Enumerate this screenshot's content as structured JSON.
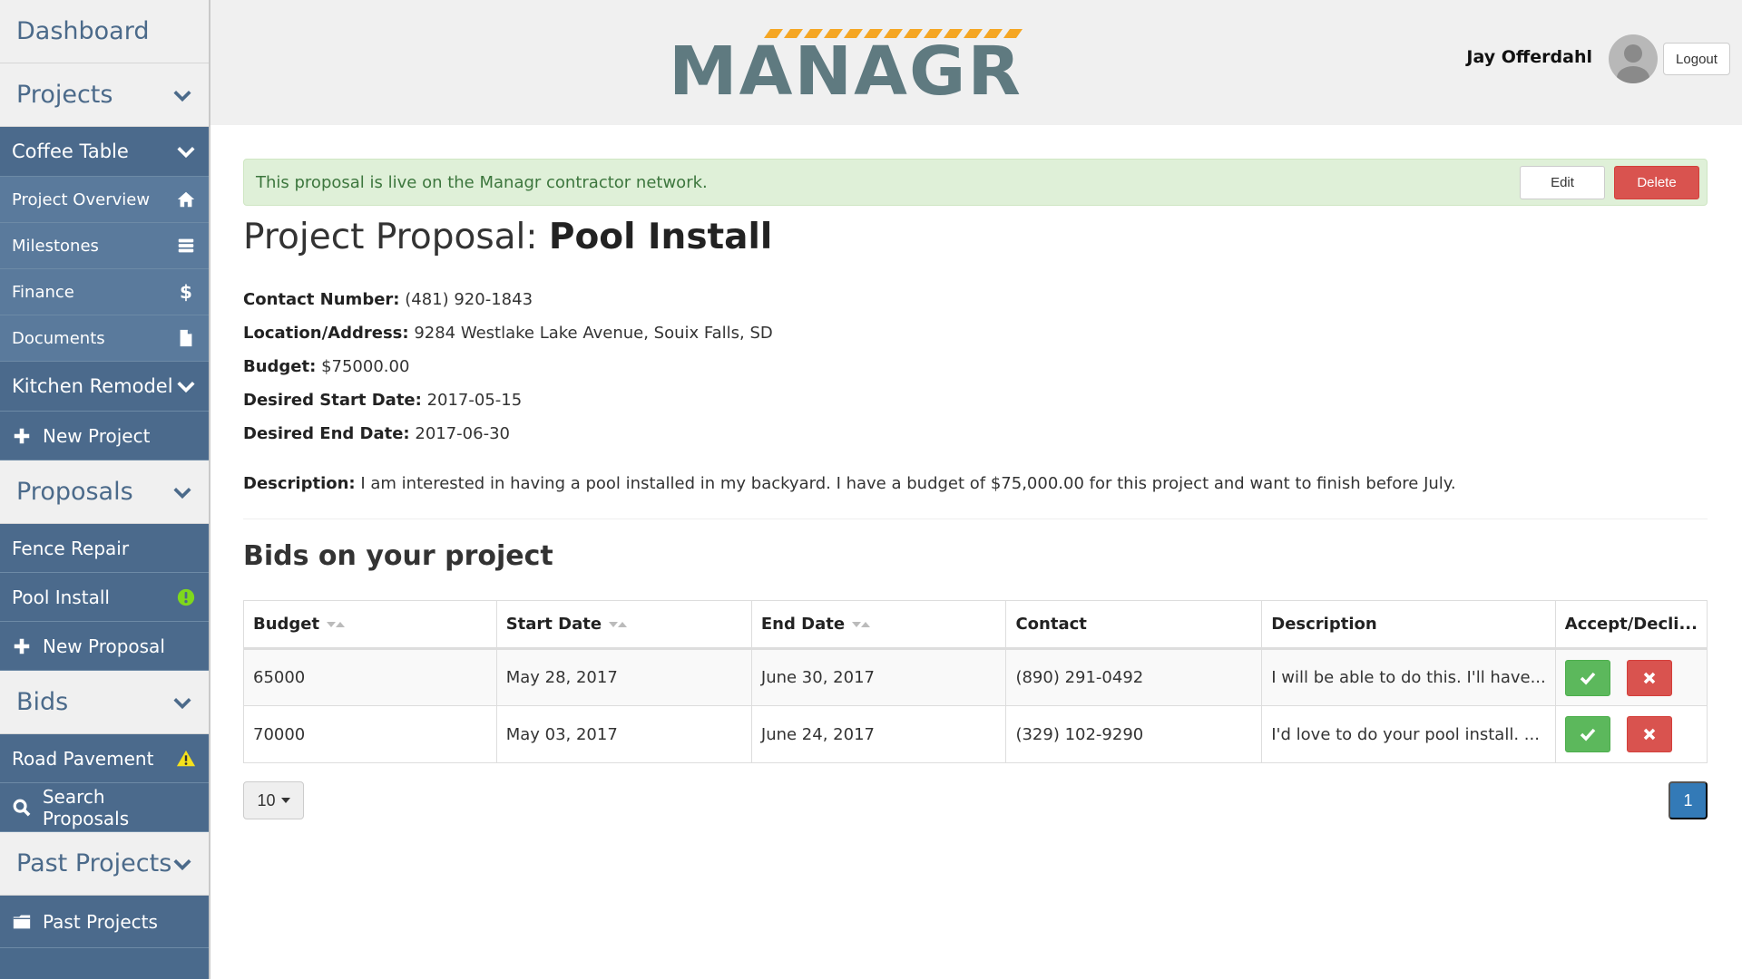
{
  "sidebar": {
    "dashboard": "Dashboard",
    "projects_header": "Projects",
    "projects": [
      {
        "label": "Coffee Table",
        "sub_items": [
          {
            "label": "Project Overview",
            "icon": "home-icon"
          },
          {
            "label": "Milestones",
            "icon": "list-icon"
          },
          {
            "label": "Finance",
            "icon": "dollar-icon"
          },
          {
            "label": "Documents",
            "icon": "document-icon"
          }
        ]
      },
      {
        "label": "Kitchen Remodel"
      }
    ],
    "new_project": "New Project",
    "proposals_header": "Proposals",
    "proposals": [
      {
        "label": "Fence Repair"
      },
      {
        "label": "Pool Install",
        "badge_icon": "exclamation-circle-icon",
        "badge_color": "#7fd81c"
      }
    ],
    "new_proposal": "New Proposal",
    "bids_header": "Bids",
    "bids": [
      {
        "label": "Road Pavement",
        "badge_icon": "warning-icon",
        "badge_color": "#f5e11b"
      }
    ],
    "search_proposals": "Search Proposals",
    "past_projects_header": "Past Projects",
    "past_projects": "Past Projects"
  },
  "header": {
    "logo_text": "MANAGR",
    "logo_stripe_color": "#f5a623",
    "logo_text_color": "#5f7a80",
    "user_name": "Jay Offerdahl",
    "logout_label": "Logout"
  },
  "alert": {
    "text": "This proposal is live on the Managr contractor network.",
    "edit_label": "Edit",
    "delete_label": "Delete"
  },
  "proposal": {
    "title_prefix": "Project Proposal:",
    "title_name": "Pool Install",
    "contact_label": "Contact Number:",
    "contact_value": "(481) 920-1843",
    "location_label": "Location/Address:",
    "location_value": "9284 Westlake Lake Avenue, Souix Falls, SD",
    "budget_label": "Budget:",
    "budget_value": "$75000.00",
    "start_label": "Desired Start Date:",
    "start_value": "2017-05-15",
    "end_label": "Desired End Date:",
    "end_value": "2017-06-30",
    "description_label": "Description:",
    "description_value": "I am interested in having a pool installed in my backyard. I have a budget of $75,000.00 for this project and want to finish before July."
  },
  "bids": {
    "title": "Bids on your project",
    "columns": [
      "Budget",
      "Start Date",
      "End Date",
      "Contact",
      "Description",
      "Accept/Decli..."
    ],
    "rows": [
      {
        "budget": "65000",
        "start": "May 28, 2017",
        "end": "June 30, 2017",
        "contact": "(890) 291-0492",
        "description": "I will be able to do this. I'll have..."
      },
      {
        "budget": "70000",
        "start": "May 03, 2017",
        "end": "June 24, 2017",
        "contact": "(329) 102-9290",
        "description": "I'd love to do your pool install. ..."
      }
    ],
    "page_size": "10",
    "current_page": "1"
  },
  "colors": {
    "sidebar_bg": "#4b6a8c",
    "success": "#5cb85c",
    "danger": "#d9534f",
    "primary": "#337ab7",
    "alert_bg": "#dff0d8"
  }
}
